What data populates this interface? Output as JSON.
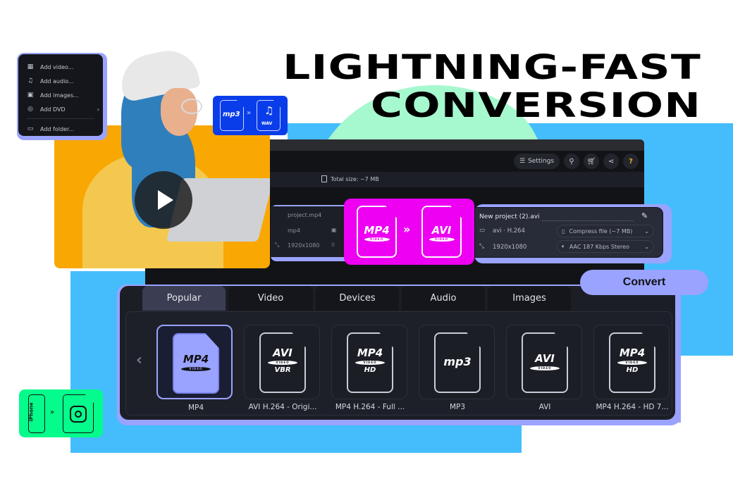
{
  "headline": {
    "line1": "LIGHTNING-FAST",
    "line2": "CONVERSION"
  },
  "add_menu": {
    "items": [
      {
        "label": "Add video...",
        "icon": "video-icon"
      },
      {
        "label": "Add audio...",
        "icon": "music-note-icon"
      },
      {
        "label": "Add images...",
        "icon": "image-icon"
      },
      {
        "label": "Add DVD",
        "icon": "dvd-icon",
        "submenu_arrow": "›"
      },
      {
        "label": "Add folder...",
        "icon": "folder-icon"
      }
    ]
  },
  "badges": {
    "audio": {
      "from": "mp3",
      "to": "WAV",
      "arrow": "»"
    },
    "mobile": {
      "from": "iPhone",
      "to": "instagram",
      "arrow": "»"
    }
  },
  "toolbar": {
    "settings_label": "Settings",
    "buttons": [
      "search-icon",
      "cart-icon",
      "share-icon",
      "help-icon"
    ],
    "help_glyph": "?"
  },
  "infobar": {
    "total_size": "Total size: ~7 MB"
  },
  "source_file": {
    "name": "project.mp4",
    "format": "mp4",
    "resolution": "1920x1080"
  },
  "conversion": {
    "from": "MP4",
    "to": "AVI",
    "band": "VIDEO",
    "arrow": "»"
  },
  "output_file": {
    "name": "New project (2).avi",
    "format": "avi · H.264",
    "resolution": "1920x1080",
    "compress": "Compress file (~7 MB)",
    "audio": "AAC 187 Kbps Stereo"
  },
  "format_panel": {
    "tabs": [
      {
        "label": "Popular",
        "active": true
      },
      {
        "label": "Video",
        "active": false
      },
      {
        "label": "Devices",
        "active": false
      },
      {
        "label": "Audio",
        "active": false
      },
      {
        "label": "Images",
        "active": false
      }
    ],
    "prev_arrow": "‹",
    "tiles": [
      {
        "title": "MP4",
        "band": "VIDEO",
        "sub": "",
        "label": "MP4",
        "active": true
      },
      {
        "title": "AVI",
        "band": "VIDEO",
        "sub": "VBR",
        "label": "AVI H.264 - Origi...",
        "active": false
      },
      {
        "title": "MP4",
        "band": "VIDEO",
        "sub": "HD",
        "label": "MP4 H.264 - Full ...",
        "active": false
      },
      {
        "title": "mp3",
        "band": "",
        "sub": "",
        "label": "MP3",
        "active": false
      },
      {
        "title": "AVI",
        "band": "VIDEO",
        "sub": "",
        "label": "AVI",
        "active": false
      },
      {
        "title": "MP4",
        "band": "VIDEO",
        "sub": "HD",
        "label": "MP4 H.264 - HD 7...",
        "active": false
      }
    ]
  },
  "convert_button": "Convert",
  "colors": {
    "accent_periwinkle": "#9aa3ff",
    "sky_blue": "#45bdfc",
    "mint": "#a6f8cf",
    "magenta": "#ee00f3",
    "royal_blue": "#0a3dea",
    "neon_green": "#05fb8b",
    "orange": "#f9a703",
    "dark_bg": "#1c1e26"
  }
}
